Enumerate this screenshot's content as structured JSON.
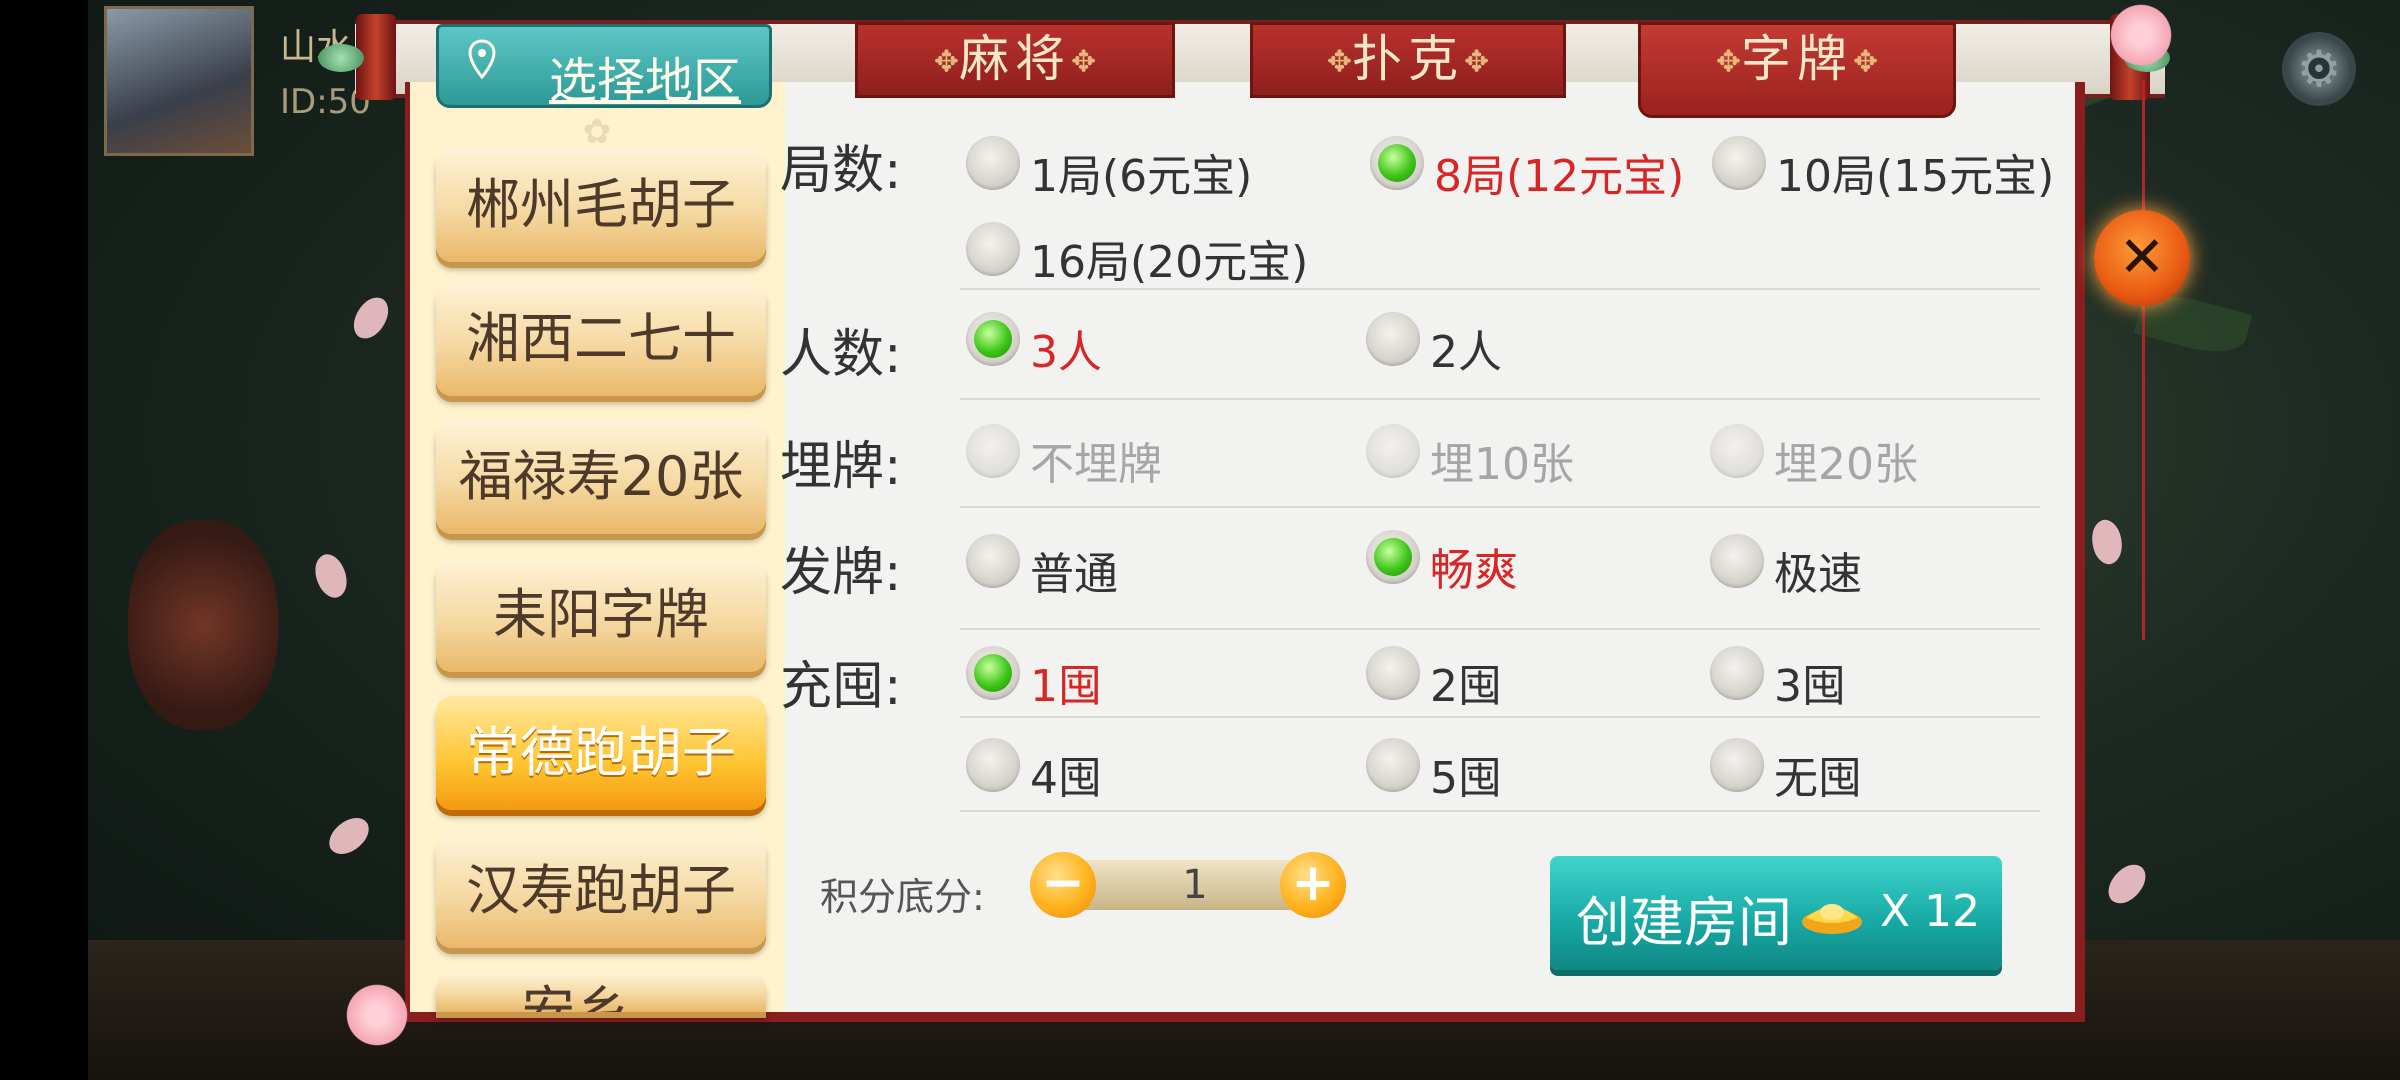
{
  "player": {
    "name": "山水",
    "id": "ID:50"
  },
  "header": {
    "region_label": "选择地区",
    "tabs": [
      {
        "label": "麻将",
        "selected": false
      },
      {
        "label": "扑克",
        "selected": false
      },
      {
        "label": "字牌",
        "selected": true
      }
    ]
  },
  "games": [
    {
      "label": "郴州毛胡子",
      "selected": false
    },
    {
      "label": "湘西二七十",
      "selected": false
    },
    {
      "label": "福禄寿20张",
      "selected": false
    },
    {
      "label": "耒阳字牌",
      "selected": false
    },
    {
      "label": "常德跑胡子",
      "selected": true
    },
    {
      "label": "汉寿跑胡子",
      "selected": false
    },
    {
      "label": "安乡...",
      "selected": false
    }
  ],
  "options": {
    "rounds": {
      "label": "局数:",
      "choices": [
        "1局(6元宝)",
        "8局(12元宝)",
        "10局(15元宝)",
        "16局(20元宝)"
      ],
      "selected": 1
    },
    "players": {
      "label": "人数:",
      "choices": [
        "3人",
        "2人"
      ],
      "selected": 0
    },
    "bury": {
      "label": "埋牌:",
      "choices": [
        "不埋牌",
        "埋10张",
        "埋20张"
      ],
      "disabled": true
    },
    "deal": {
      "label": "发牌:",
      "choices": [
        "普通",
        "畅爽",
        "极速"
      ],
      "selected": 1
    },
    "chongwei": {
      "label": "充囤:",
      "choices": [
        "1囤",
        "2囤",
        "3囤",
        "4囤",
        "5囤",
        "无囤"
      ],
      "selected": 0
    }
  },
  "score": {
    "label": "积分底分:",
    "value": "1"
  },
  "create": {
    "label": "创建房间",
    "cost": "X 12"
  },
  "icons": [
    "location-pin-icon",
    "gear-icon",
    "close-icon",
    "gold-ingot-icon",
    "minus-icon",
    "plus-icon"
  ],
  "colors": {
    "accent_red": "#d62626",
    "teal": "#17a7a3",
    "selected_gold": "#ffc430",
    "frame_red": "#8a1d1d"
  }
}
